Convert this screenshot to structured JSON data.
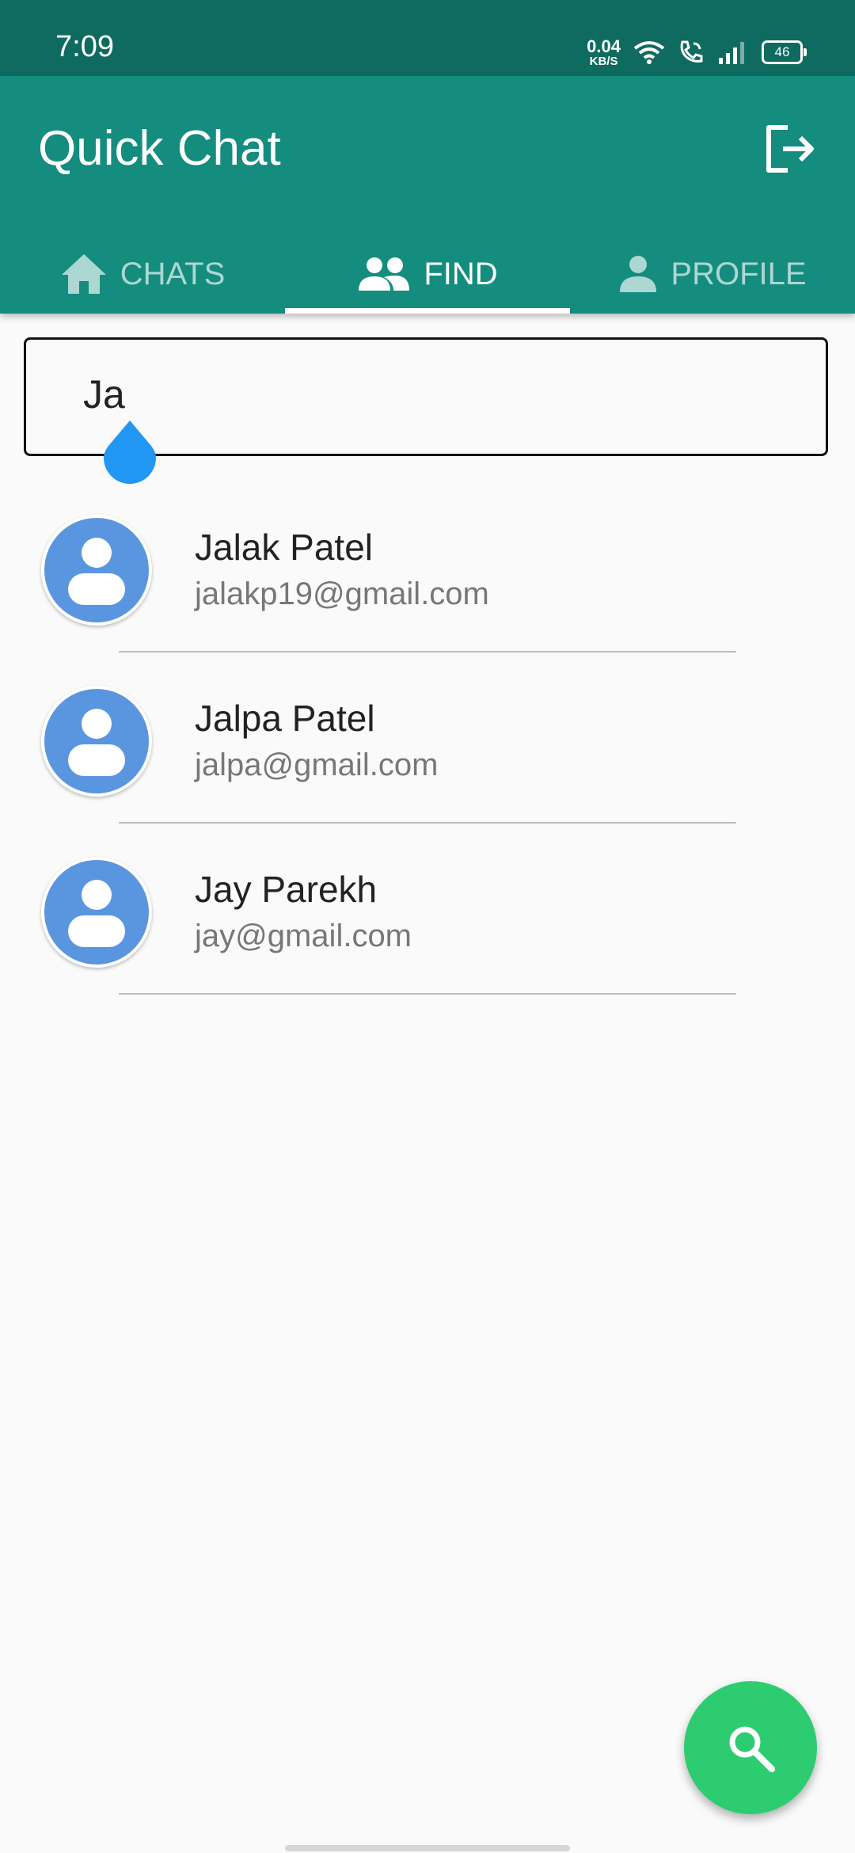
{
  "status_bar": {
    "time": "7:09",
    "net_speed_value": "0.04",
    "net_speed_unit": "KB/S",
    "battery": "46"
  },
  "app_bar": {
    "title": "Quick Chat",
    "logout_icon": "logout-icon"
  },
  "tabs": [
    {
      "label": "CHATS",
      "icon": "home-icon",
      "active": false
    },
    {
      "label": "FIND",
      "icon": "people-icon",
      "active": true
    },
    {
      "label": "PROFILE",
      "icon": "person-icon",
      "active": false
    }
  ],
  "search": {
    "value": "Ja"
  },
  "results": [
    {
      "name": "Jalak Patel",
      "email": "jalakp19@gmail.com"
    },
    {
      "name": "Jalpa Patel",
      "email": "jalpa@gmail.com"
    },
    {
      "name": "Jay Parekh",
      "email": "jay@gmail.com"
    }
  ],
  "fab": {
    "icon": "search-icon"
  },
  "colors": {
    "status_bar": "#0f6b5f",
    "app_bar": "#148c7e",
    "avatar": "#5a96e0",
    "caret": "#2196f3",
    "fab": "#2ecc71"
  }
}
